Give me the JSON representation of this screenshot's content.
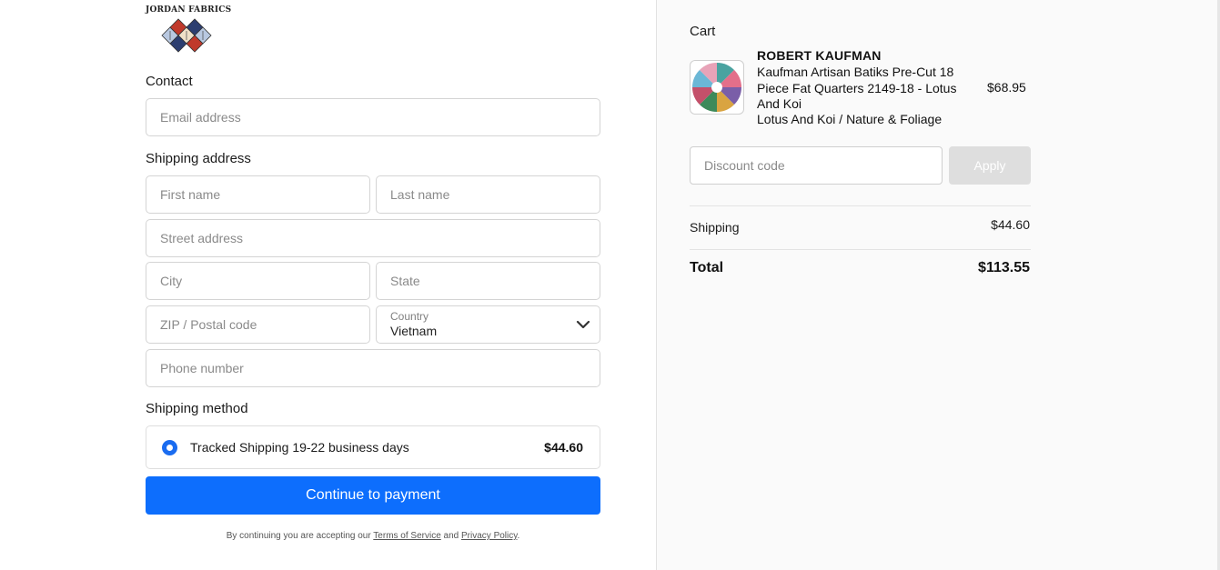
{
  "brand": {
    "name": "JORDAN FABRICS"
  },
  "contact": {
    "heading": "Contact",
    "email_placeholder": "Email address"
  },
  "shipping_address": {
    "heading": "Shipping address",
    "first_name_placeholder": "First name",
    "last_name_placeholder": "Last name",
    "street_placeholder": "Street address",
    "city_placeholder": "City",
    "state_placeholder": "State",
    "zip_placeholder": "ZIP / Postal code",
    "country_label": "Country",
    "country_value": "Vietnam",
    "phone_placeholder": "Phone number"
  },
  "shipping_method": {
    "heading": "Shipping method",
    "option_label": "Tracked Shipping 19-22 business days",
    "option_price": "$44.60",
    "selected": true
  },
  "actions": {
    "continue_label": "Continue to payment"
  },
  "legal": {
    "prefix": "By continuing you are accepting our",
    "terms": "Terms of Service",
    "and": "and",
    "privacy": "Privacy Policy",
    "suffix": "."
  },
  "cart": {
    "heading": "Cart",
    "item": {
      "vendor": "ROBERT KAUFMAN",
      "title": "Kaufman Artisan Batiks Pre-Cut 18 Piece Fat Quarters 2149-18 - Lotus And Koi",
      "variant": "Lotus And Koi / Nature & Foliage",
      "price": "$68.95",
      "thumbnail_icon": "fabric-bundle-thumbnail"
    },
    "discount_placeholder": "Discount code",
    "apply_label": "Apply",
    "shipping_label": "Shipping",
    "shipping_value": "$44.60",
    "total_label": "Total",
    "total_value": "$113.55"
  },
  "colors": {
    "primary": "#0d6efd",
    "apply_disabled": "#dedede",
    "summary_bg": "#fafafa"
  }
}
